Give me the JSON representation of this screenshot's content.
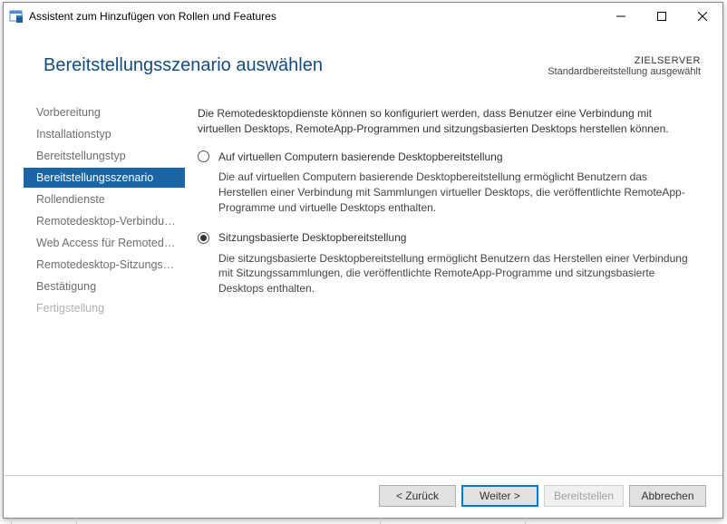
{
  "titlebar": {
    "title": "Assistent zum Hinzufügen von Rollen und Features"
  },
  "header": {
    "title": "Bereitstellungsszenario auswählen",
    "target_label": "ZIELSERVER",
    "target_value": "Standardbereitstellung ausgewählt"
  },
  "sidebar": {
    "items": [
      {
        "label": "Vorbereitung",
        "state": "normal"
      },
      {
        "label": "Installationstyp",
        "state": "normal"
      },
      {
        "label": "Bereitstellungstyp",
        "state": "normal"
      },
      {
        "label": "Bereitstellungsszenario",
        "state": "active"
      },
      {
        "label": "Rollendienste",
        "state": "normal"
      },
      {
        "label": "Remotedesktop-Verbindungsbroker",
        "state": "normal"
      },
      {
        "label": "Web Access für Remotedesktop",
        "state": "normal"
      },
      {
        "label": "Remotedesktop-Sitzungshost",
        "state": "normal"
      },
      {
        "label": "Bestätigung",
        "state": "normal"
      },
      {
        "label": "Fertigstellung",
        "state": "disabled"
      }
    ]
  },
  "main": {
    "intro": "Die Remotedesktopdienste können so konfiguriert werden, dass Benutzer eine Verbindung mit virtuellen Desktops, RemoteApp-Programmen und sitzungsbasierten Desktops herstellen können.",
    "options": [
      {
        "label": "Auf virtuellen Computern basierende Desktopbereitstellung",
        "desc": "Die auf virtuellen Computern basierende Desktopbereitstellung ermöglicht Benutzern das Herstellen einer Verbindung mit Sammlungen virtueller Desktops, die veröffentlichte RemoteApp-Programme und virtuelle Desktops enthalten.",
        "checked": false
      },
      {
        "label": "Sitzungsbasierte Desktopbereitstellung",
        "desc": "Die sitzungsbasierte Desktopbereitstellung ermöglicht Benutzern das Herstellen einer Verbindung mit Sitzungssammlungen, die veröffentlichte RemoteApp-Programme und sitzungsbasierte Desktops enthalten.",
        "checked": true
      }
    ]
  },
  "footer": {
    "back": "< Zurück",
    "next": "Weiter >",
    "deploy": "Bereitstellen",
    "cancel": "Abbrechen"
  }
}
